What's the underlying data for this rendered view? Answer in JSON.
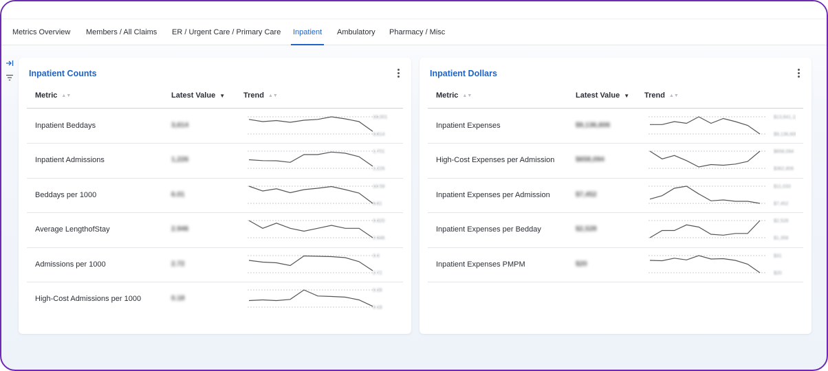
{
  "tabs": [
    {
      "label": "Metrics Overview"
    },
    {
      "label": "Members / All Claims"
    },
    {
      "label": "ER / Urgent Care / Primary Care"
    },
    {
      "label": "Inpatient",
      "active": true
    },
    {
      "label": "Ambulatory"
    },
    {
      "label": "Pharmacy / Misc"
    }
  ],
  "left_panel": {
    "title": "Inpatient Counts",
    "columns": {
      "metric": "Metric",
      "latest": "Latest Value",
      "trend": "Trend"
    },
    "rows": [
      {
        "metric": "Inpatient Beddays",
        "value": "3,614",
        "max_label": "19,001",
        "min_label": "3,614",
        "trend": [
          0.85,
          0.72,
          0.78,
          0.68,
          0.8,
          0.85,
          1.0,
          0.88,
          0.72,
          0.15
        ]
      },
      {
        "metric": "Inpatient Admissions",
        "value": "1,226",
        "max_label": "1,701",
        "min_label": "1,226",
        "trend": [
          0.5,
          0.45,
          0.44,
          0.35,
          0.8,
          0.8,
          0.95,
          0.88,
          0.68,
          0.12
        ]
      },
      {
        "metric": "Beddays per 1000",
        "value": "6.01",
        "max_label": "10.59",
        "min_label": "6.01",
        "trend": [
          1.0,
          0.72,
          0.85,
          0.62,
          0.8,
          0.88,
          0.98,
          0.8,
          0.6,
          0.0
        ]
      },
      {
        "metric": "Average LengthofStay",
        "value": "2.946",
        "max_label": "3.320",
        "min_label": "2.946",
        "trend": [
          1.0,
          0.55,
          0.85,
          0.55,
          0.38,
          0.55,
          0.72,
          0.55,
          0.55,
          0.0
        ]
      },
      {
        "metric": "Admissions per 1000",
        "value": "2.72",
        "max_label": "3.3",
        "min_label": "2.72",
        "trend": [
          0.72,
          0.62,
          0.58,
          0.42,
          0.98,
          0.96,
          0.94,
          0.88,
          0.65,
          0.12
        ]
      },
      {
        "metric": "High-Cost Admissions per 1000",
        "value": "0.18",
        "max_label": "0.28",
        "min_label": "0.18",
        "trend": [
          0.38,
          0.42,
          0.38,
          0.45,
          1.0,
          0.65,
          0.62,
          0.58,
          0.42,
          0.05
        ]
      }
    ]
  },
  "right_panel": {
    "title": "Inpatient Dollars",
    "columns": {
      "metric": "Metric",
      "latest": "Latest Value",
      "trend": "Trend"
    },
    "rows": [
      {
        "metric": "Inpatient Expenses",
        "value": "$9,136,606",
        "max_label": "$13,641,115",
        "min_label": "$9,136,606",
        "trend": [
          0.55,
          0.55,
          0.72,
          0.62,
          1.0,
          0.62,
          0.9,
          0.72,
          0.5,
          0.0
        ]
      },
      {
        "metric": "High-Cost Expenses per Admission",
        "value": "$658,094",
        "max_label": "$658,094",
        "min_label": "$362,806",
        "trend": [
          1.0,
          0.55,
          0.75,
          0.45,
          0.08,
          0.22,
          0.18,
          0.25,
          0.4,
          1.0
        ]
      },
      {
        "metric": "Inpatient Expenses per Admission",
        "value": "$7,452",
        "max_label": "$11,033",
        "min_label": "$7,452",
        "trend": [
          0.25,
          0.45,
          0.88,
          1.0,
          0.55,
          0.15,
          0.2,
          0.12,
          0.12,
          0.0
        ]
      },
      {
        "metric": "Inpatient Expenses per Bedday",
        "value": "$2,528",
        "max_label": "$2,528",
        "min_label": "$1,358",
        "trend": [
          0.0,
          0.42,
          0.42,
          0.75,
          0.62,
          0.2,
          0.15,
          0.25,
          0.25,
          1.0
        ]
      },
      {
        "metric": "Inpatient Expenses PMPM",
        "value": "$20",
        "max_label": "$31",
        "min_label": "$20",
        "trend": [
          0.72,
          0.7,
          0.85,
          0.75,
          1.0,
          0.8,
          0.82,
          0.72,
          0.5,
          0.0
        ]
      }
    ]
  },
  "icons": {
    "collapse": "collapse-sidebar-icon",
    "filter": "filter-icon",
    "menu": "kebab-menu-icon",
    "sort": "sort-icon",
    "sort_desc": "sort-desc-icon"
  },
  "colors": {
    "accent": "#1f63c6",
    "frame": "#6d2bb5",
    "sparkline": "#555555"
  }
}
